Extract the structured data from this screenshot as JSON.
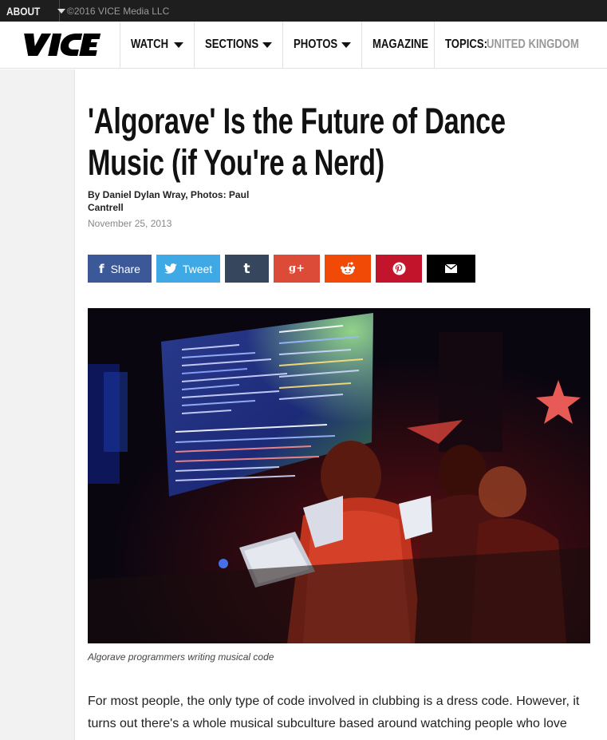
{
  "topbar": {
    "about_label": "ABOUT",
    "copyright": "©2016 VICE Media LLC"
  },
  "nav": {
    "logo_text": "VICE",
    "items": [
      {
        "label": "WATCH"
      },
      {
        "label": "SECTIONS"
      },
      {
        "label": "PHOTOS"
      },
      {
        "label": "MAGAZINE"
      }
    ],
    "topics_label": "TOPICS:",
    "topics_value": "UNITED KINGDOM"
  },
  "article": {
    "headline_line1": "'Algorave' Is the Future of Dance",
    "headline_line2": "Music (if You're a Nerd)",
    "byline": "By Daniel Dylan Wray, Photos: Paul Cantrell",
    "date": "November 25, 2013",
    "share": {
      "facebook_label": "Share",
      "twitter_label": "Tweet"
    },
    "caption": "Algorave programmers writing musical code",
    "paragraph": "For most people, the only type of code involved in clubbing is a dress code. However, it turns out there's a whole musical subculture based around watching people who love"
  },
  "colors": {
    "facebook": "#3b5998",
    "twitter": "#3fa9e6",
    "tumblr": "#36465d",
    "google_plus": "#dc4a38",
    "reddit": "#f04a06",
    "pinterest": "#c2142a",
    "email": "#000000"
  },
  "icons": [
    "facebook-icon",
    "twitter-icon",
    "tumblr-icon",
    "google-plus-icon",
    "reddit-icon",
    "pinterest-icon",
    "email-icon"
  ]
}
